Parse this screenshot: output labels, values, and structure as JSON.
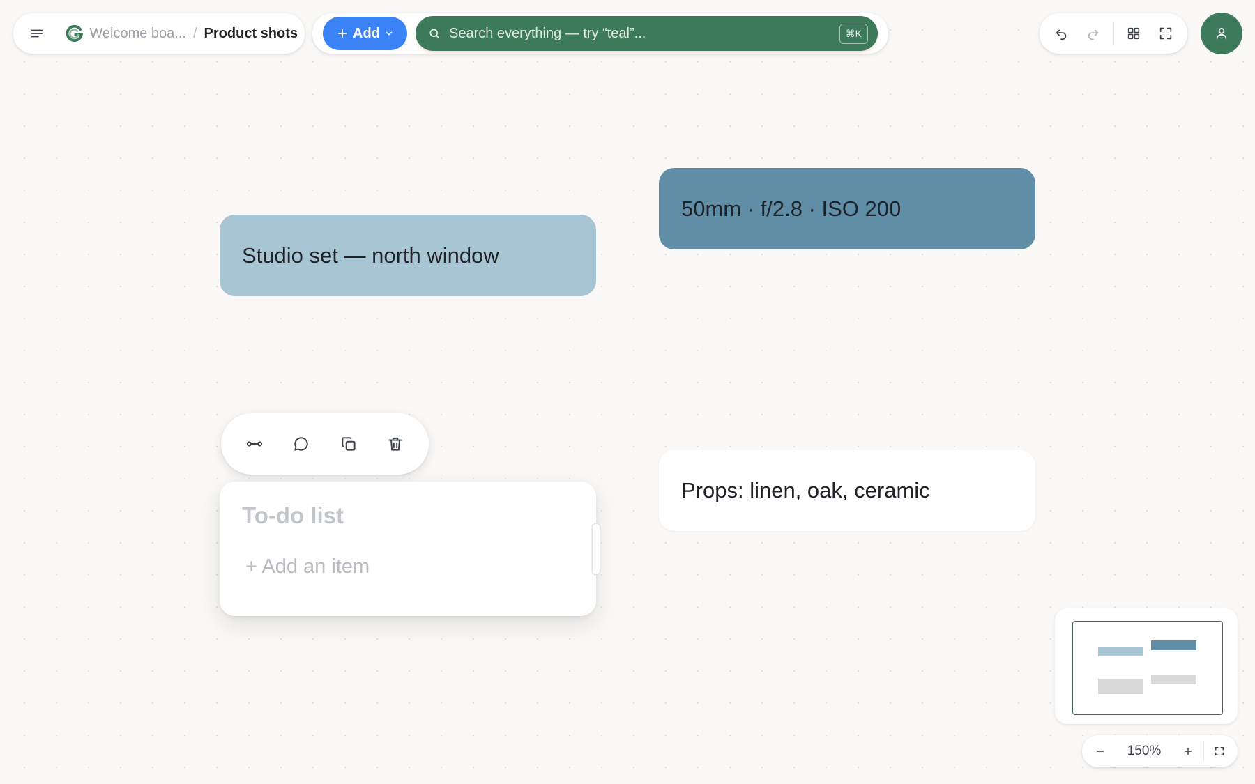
{
  "breadcrumb": {
    "parent": "Welcome boa...",
    "separator": "/",
    "current": "Product shots"
  },
  "toolbar": {
    "add_label": "Add",
    "search_placeholder": "Search everything — try “teal”...",
    "search_shortcut": "⌘K"
  },
  "cards": {
    "studio": "Studio set — north window",
    "lens": "50mm · f/2.8 · ISO 200",
    "props": "Props: linen, oak, ceramic"
  },
  "todo": {
    "title": "To-do list",
    "add_item": "+ Add an item"
  },
  "zoom": {
    "level": "150%"
  },
  "colors": {
    "background": "#f9f8f6",
    "add_button": "#3b82f6",
    "search_bar": "#3d7a5a",
    "avatar": "#3d7a5a",
    "card_light_blue": "#a8c5d3",
    "card_steel_blue": "#5f8ea6",
    "card_white": "#ffffff"
  },
  "icons": {
    "menu": "hamburger-menu-icon",
    "logo": "app-logo-icon",
    "add": "plus-icon",
    "add_dropdown": "chevron-down-icon",
    "search": "search-icon",
    "undo": "undo-icon",
    "redo": "redo-icon",
    "grid": "grid-icon",
    "fullscreen": "fullscreen-icon",
    "user": "user-icon",
    "connect": "connector-icon",
    "comment": "comment-icon",
    "duplicate": "duplicate-icon",
    "delete": "trash-icon",
    "zoom_out": "minus-icon",
    "zoom_in": "plus-icon",
    "fit": "fit-screen-icon"
  }
}
